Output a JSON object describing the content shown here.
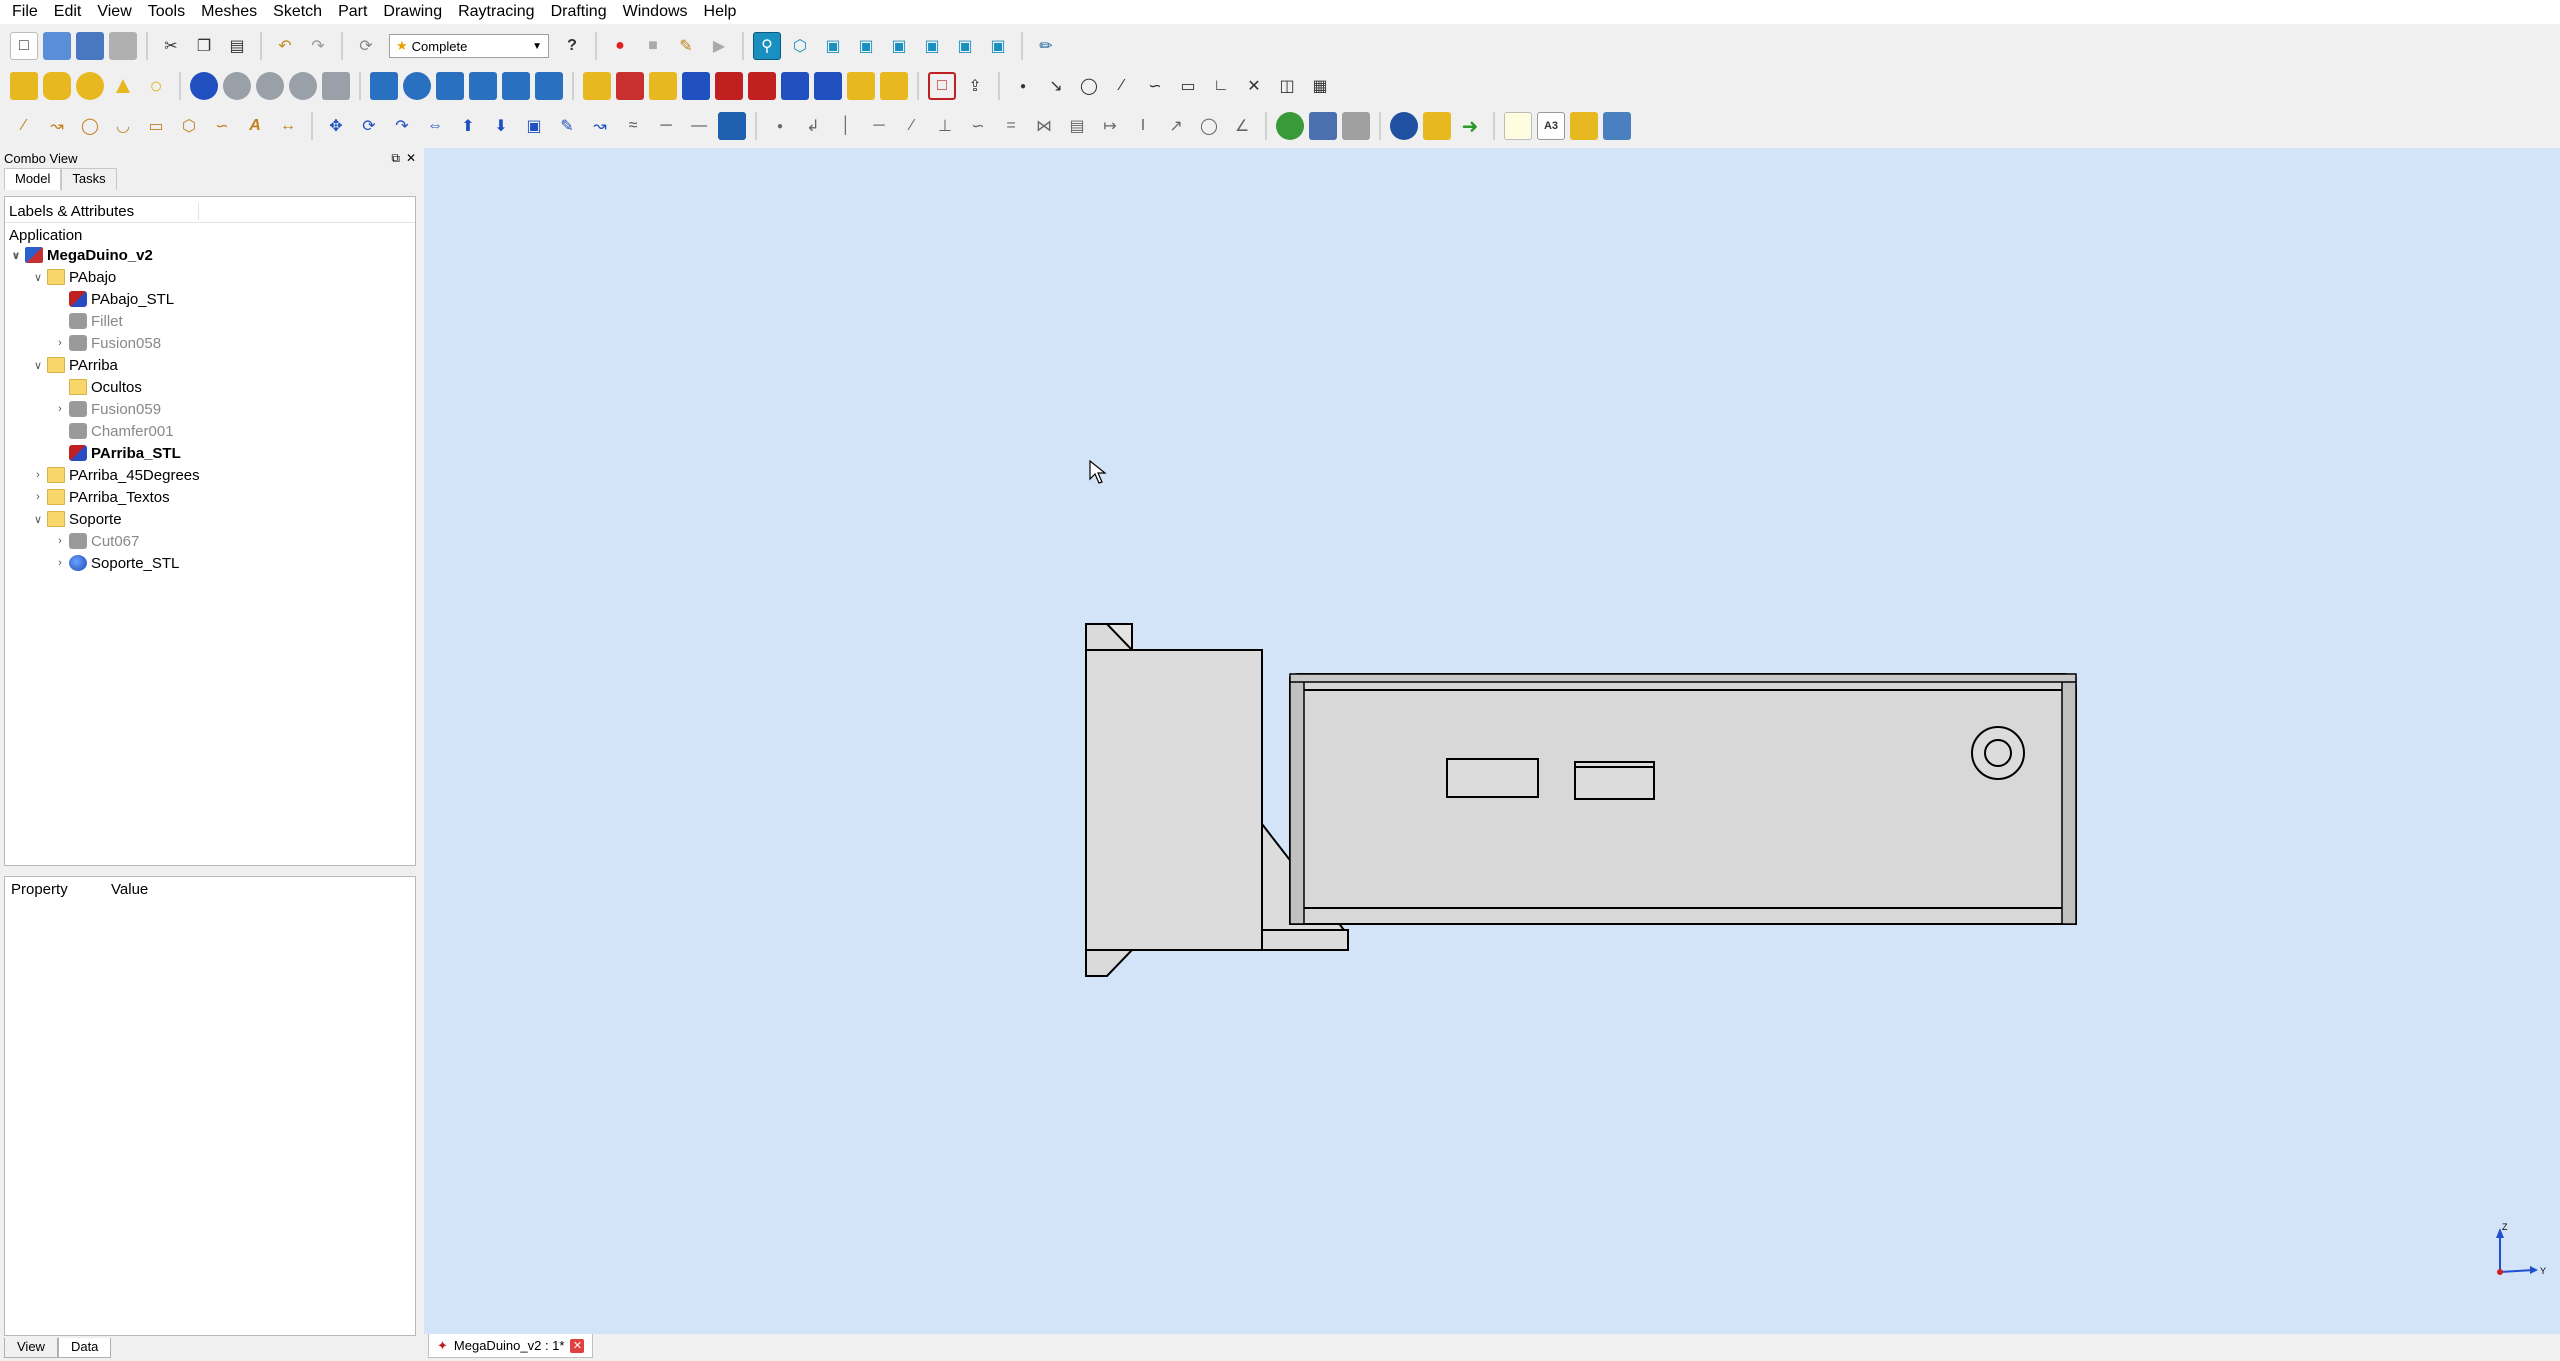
{
  "menubar": {
    "items": [
      "File",
      "Edit",
      "View",
      "Tools",
      "Meshes",
      "Sketch",
      "Part",
      "Drawing",
      "Raytracing",
      "Drafting",
      "Windows",
      "Help"
    ]
  },
  "toolbar": {
    "workbench_select": "Complete",
    "text_icons": {
      "a3": "A3",
      "text_tool": "A"
    }
  },
  "combo_view": {
    "title": "Combo View",
    "tabs": [
      "Model",
      "Tasks"
    ],
    "tree_header": "Labels & Attributes",
    "application_label": "Application",
    "tree": [
      {
        "label": "MegaDuino_v2",
        "level": 0,
        "expander": "open",
        "icon": "doc",
        "style": "bold"
      },
      {
        "label": "PAbajo",
        "level": 1,
        "expander": "open",
        "icon": "folder",
        "style": ""
      },
      {
        "label": "PAbajo_STL",
        "level": 2,
        "expander": "",
        "icon": "solid-rb",
        "style": ""
      },
      {
        "label": "Fillet",
        "level": 2,
        "expander": "",
        "icon": "solid-gray",
        "style": "dim"
      },
      {
        "label": "Fusion058",
        "level": 2,
        "expander": "closed",
        "icon": "solid-gray",
        "style": "dim"
      },
      {
        "label": "PArriba",
        "level": 1,
        "expander": "open",
        "icon": "folder",
        "style": ""
      },
      {
        "label": "Ocultos",
        "level": 2,
        "expander": "",
        "icon": "folder",
        "style": ""
      },
      {
        "label": "Fusion059",
        "level": 2,
        "expander": "closed",
        "icon": "solid-gray",
        "style": "dim"
      },
      {
        "label": "Chamfer001",
        "level": 2,
        "expander": "",
        "icon": "solid-gray",
        "style": "dim"
      },
      {
        "label": "PArriba_STL",
        "level": 2,
        "expander": "",
        "icon": "solid-rb",
        "style": "bold"
      },
      {
        "label": "PArriba_45Degrees",
        "level": 1,
        "expander": "closed",
        "icon": "folder",
        "style": ""
      },
      {
        "label": "PArriba_Textos",
        "level": 1,
        "expander": "closed",
        "icon": "folder",
        "style": ""
      },
      {
        "label": "Soporte",
        "level": 1,
        "expander": "open",
        "icon": "folder",
        "style": ""
      },
      {
        "label": "Cut067",
        "level": 2,
        "expander": "closed",
        "icon": "solid-gray",
        "style": "dim"
      },
      {
        "label": "Soporte_STL",
        "level": 2,
        "expander": "closed",
        "icon": "solid-blue",
        "style": ""
      }
    ],
    "property_header": {
      "property": "Property",
      "value": "Value"
    },
    "bottom_tabs": [
      "View",
      "Data"
    ]
  },
  "view3d": {
    "background": "#d4e4f8",
    "axis_labels": {
      "z": "Z",
      "y": "Y"
    }
  },
  "document_tabs": [
    {
      "label": "MegaDuino_v2 : 1*"
    }
  ],
  "colors": {
    "model_fill": "#dcdcdc",
    "model_stroke": "#000000",
    "axis_z": "#2050d0",
    "axis_y": "#2050d0",
    "axis_x": "#d02020"
  }
}
